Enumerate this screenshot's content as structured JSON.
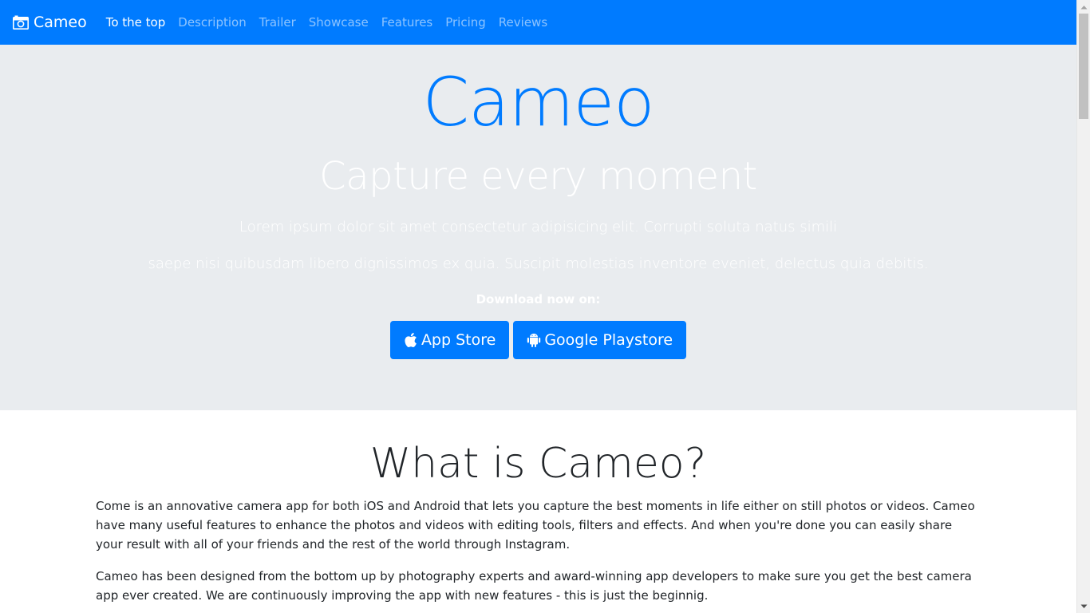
{
  "navbar": {
    "brand": "Cameo",
    "brand_icon": "camera-icon",
    "background": "#007bff",
    "items": [
      {
        "label": "To the top",
        "active": true
      },
      {
        "label": "Description",
        "active": false
      },
      {
        "label": "Trailer",
        "active": false
      },
      {
        "label": "Showcase",
        "active": false
      },
      {
        "label": "Features",
        "active": false
      },
      {
        "label": "Pricing",
        "active": false
      },
      {
        "label": "Reviews",
        "active": false
      }
    ]
  },
  "hero": {
    "title": "Cameo",
    "subtitle": "Capture every moment",
    "lead_line1": "Lorem ipsum dolor sit amet consectetur adipisicing elit. Corrupti soluta natus simili",
    "lead_line2": "saepe nisi quibusdam libero dignissimos ex quia. Suscipit molestias inventore eveniet, delectus quia debitis.",
    "download_label": "Download now on:",
    "buttons": [
      {
        "label": "App Store",
        "icon": "apple-icon"
      },
      {
        "label": "Google Playstore",
        "icon": "android-icon"
      }
    ],
    "accent": "#007bff",
    "background": "#e9ecef"
  },
  "about": {
    "title": "What is Cameo?",
    "paragraph1": "Come is an annovative camera app for both iOS and Android that lets you capture the best moments in life either on still photos or videos. Cameo have many useful features to enhance the photos and videos with editing tools, filters and effects. And when you're done you can easily share your result with all of your friends and the rest of the world through Instagram.",
    "paragraph2": "Cameo has been designed from the bottom up by photography experts and award-winning app developers to make sure you get the best camera app ever created. We are continuously improving the app with new features - this is just the beginnig."
  }
}
